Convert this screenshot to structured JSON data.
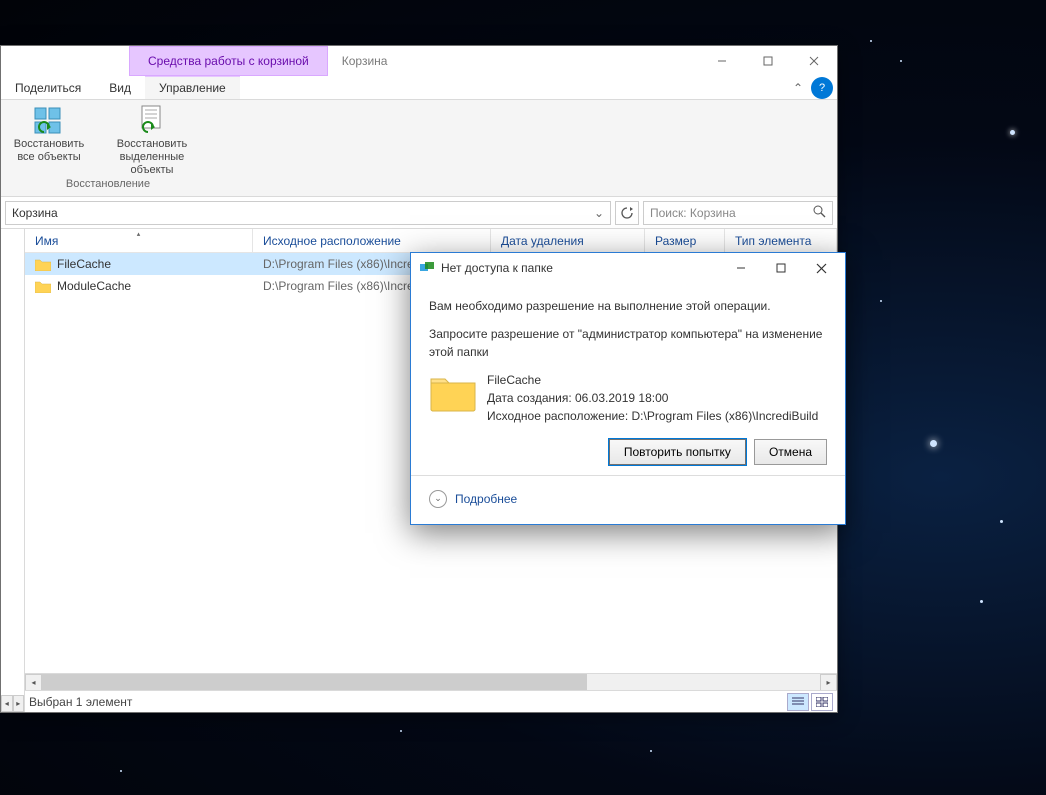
{
  "titlebar": {
    "context_tab": "Средства работы с корзиной",
    "title": "Корзина"
  },
  "tabs": {
    "share": "Поделиться",
    "view": "Вид",
    "manage": "Управление"
  },
  "ribbon": {
    "restore_all_l1": "Восстановить",
    "restore_all_l2": "все объекты",
    "restore_sel_l1": "Восстановить",
    "restore_sel_l2": "выделенные объекты",
    "group": "Восстановление"
  },
  "address": {
    "path": "Корзина",
    "search_placeholder": "Поиск: Корзина"
  },
  "columns": {
    "name": "Имя",
    "orig": "Исходное расположение",
    "deleted": "Дата удаления",
    "size": "Размер",
    "type": "Тип элемента"
  },
  "col_widths": {
    "name": 228,
    "orig": 238,
    "deleted": 154,
    "size": 80,
    "type": 120
  },
  "items": [
    {
      "name": "FileCache",
      "orig": "D:\\Program Files (x86)\\IncrediBuild",
      "selected": true
    },
    {
      "name": "ModuleCache",
      "orig": "D:\\Program Files (x86)\\IncrediBuild",
      "selected": false
    }
  ],
  "status": {
    "text": "Выбран 1 элемент"
  },
  "dialog": {
    "title": "Нет доступа к папке",
    "msg1": "Вам необходимо разрешение на выполнение этой операции.",
    "msg2": "Запросите разрешение от \"администратор компьютера\" на изменение этой папки",
    "folder_name": "FileCache",
    "created_label": "Дата создания: ",
    "created_value": "06.03.2019 18:00",
    "orig_label": "Исходное расположение: ",
    "orig_value": "D:\\Program Files (x86)\\IncrediBuild",
    "retry": "Повторить попытку",
    "cancel": "Отмена",
    "more": "Подробнее"
  }
}
